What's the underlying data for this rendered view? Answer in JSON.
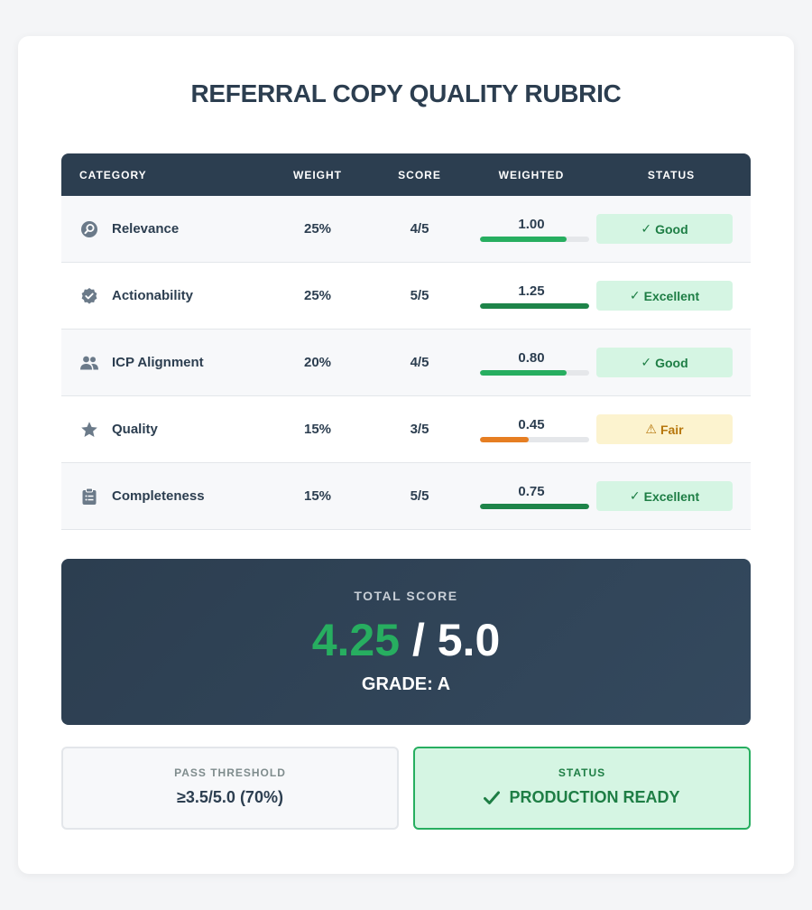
{
  "title": "REFERRAL COPY QUALITY RUBRIC",
  "table": {
    "headers": {
      "category": "CATEGORY",
      "weight": "WEIGHT",
      "score": "SCORE",
      "weighted": "WEIGHTED",
      "status": "STATUS"
    },
    "rows": [
      {
        "icon": "search-icon",
        "category": "Relevance",
        "weight": "25%",
        "score": "4/5",
        "weighted": "1.00",
        "weighted_fraction": 0.8,
        "bar_color": "#27ae60",
        "status_glyph": "✓",
        "status": "Good"
      },
      {
        "icon": "verified-badge-icon",
        "category": "Actionability",
        "weight": "25%",
        "score": "5/5",
        "weighted": "1.25",
        "weighted_fraction": 1.0,
        "bar_color": "#1e8449",
        "status_glyph": "✓",
        "status": "Excellent"
      },
      {
        "icon": "people-icon",
        "category": "ICP Alignment",
        "weight": "20%",
        "score": "4/5",
        "weighted": "0.80",
        "weighted_fraction": 0.8,
        "bar_color": "#27ae60",
        "status_glyph": "✓",
        "status": "Good"
      },
      {
        "icon": "star-icon",
        "category": "Quality",
        "weight": "15%",
        "score": "3/5",
        "weighted": "0.45",
        "weighted_fraction": 0.45,
        "bar_color": "#e67e22",
        "status_glyph": "⚠",
        "status": "Fair"
      },
      {
        "icon": "clipboard-icon",
        "category": "Completeness",
        "weight": "15%",
        "score": "5/5",
        "weighted": "0.75",
        "weighted_fraction": 1.0,
        "bar_color": "#1e8449",
        "status_glyph": "✓",
        "status": "Excellent"
      }
    ]
  },
  "total": {
    "label": "TOTAL SCORE",
    "score": "4.25",
    "separator": " / ",
    "max": "5.0",
    "grade": "GRADE: A"
  },
  "threshold": {
    "label": "PASS THRESHOLD",
    "value": "≥3.5/5.0 (70%)"
  },
  "status": {
    "label": "STATUS",
    "icon": "check-icon",
    "value": "PRODUCTION READY"
  },
  "colors": {
    "header_bg": "#2c3e50",
    "good": "#27ae60",
    "excellent": "#1e8449",
    "fair": "#e67e22"
  }
}
